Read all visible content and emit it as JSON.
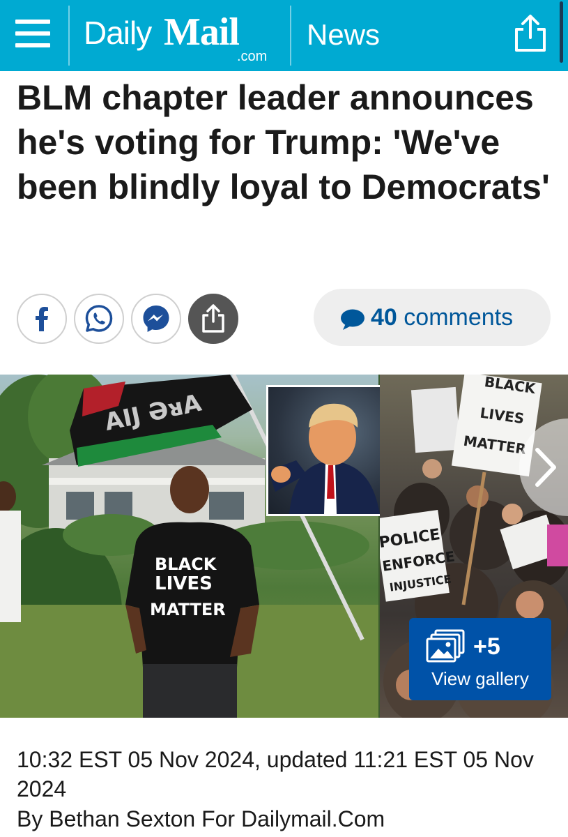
{
  "header": {
    "brand_daily": "Daily",
    "brand_mail": "Mail",
    "brand_com": ".com",
    "section": "News",
    "bg_color": "#00aad2",
    "icons": [
      "menu-icon",
      "share-icon"
    ]
  },
  "article": {
    "headline": "BLM chapter leader announces he's voting for Trump: 'We've been blindly loyal to Democrats'",
    "dateline": "10:32 EST 05 Nov 2024, updated 11:21 EST 05 Nov 2024",
    "byline": "By Bethan Sexton For Dailymail.Com"
  },
  "social": {
    "buttons": [
      {
        "name": "facebook",
        "icon": "facebook-icon"
      },
      {
        "name": "whatsapp",
        "icon": "whatsapp-icon"
      },
      {
        "name": "messenger",
        "icon": "messenger-icon"
      },
      {
        "name": "share",
        "icon": "share-icon"
      }
    ],
    "comments_count": "40",
    "comments_label": "comments",
    "comments_color": "#00579a"
  },
  "gallery": {
    "main_shirt_text": [
      "BLACK",
      "LIVES",
      "MATTER"
    ],
    "sign_1": [
      "BLACK",
      "LIVES",
      "MATTER"
    ],
    "sign_2": [
      "POLICE",
      "ENFORCE",
      "INJUSTICE"
    ],
    "more_count": "+5",
    "view_label": "View gallery",
    "button_color": "#0052a8"
  }
}
